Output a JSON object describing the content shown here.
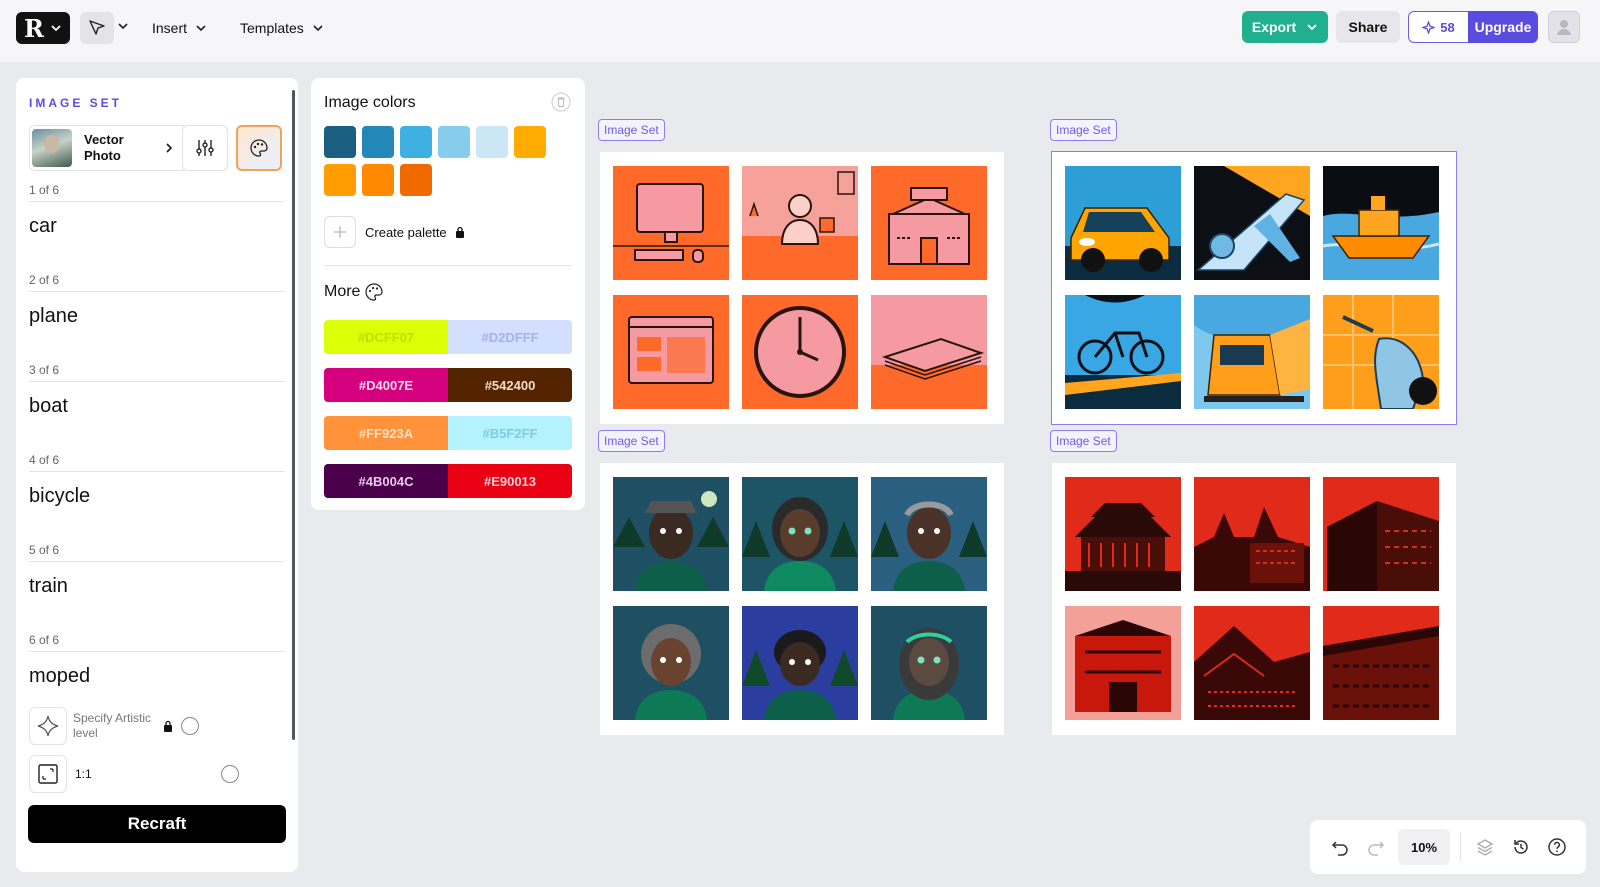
{
  "topbar": {
    "logo_mark": "R",
    "insert_label": "Insert",
    "templates_label": "Templates",
    "export_label": "Export",
    "share_label": "Share",
    "credits_count": "58",
    "upgrade_label": "Upgrade"
  },
  "image_set_panel": {
    "title": "IMAGE SET",
    "model_label": "Vector Photo",
    "items": [
      {
        "count": "1 of 6",
        "word": "car"
      },
      {
        "count": "2 of 6",
        "word": "plane"
      },
      {
        "count": "3 of 6",
        "word": "boat"
      },
      {
        "count": "4 of 6",
        "word": "bicycle"
      },
      {
        "count": "5 of 6",
        "word": "train"
      },
      {
        "count": "6 of 6",
        "word": "moped"
      }
    ],
    "specify_label": "Specify Artistic level",
    "ratio_label": "1:1",
    "recraft_label": "Recraft"
  },
  "colors_panel": {
    "title": "Image colors",
    "swatches": [
      "#1b5f80",
      "#2387b8",
      "#3fb0e2",
      "#85cdeb",
      "#cbe7f6",
      "#ffab00",
      "#ff9d00",
      "#ff8a00",
      "#f06a00"
    ],
    "create_label": "Create palette",
    "more_label": "More",
    "pairs": [
      {
        "left": "#DCFF07",
        "right": "#D2DFFF",
        "left_text": "#c8e600",
        "right_text": "#aab6e8"
      },
      {
        "left": "#D4007E",
        "right": "#542400",
        "left_text": "#ffd9ee",
        "right_text": "#f3dcc8"
      },
      {
        "left": "#FF923A",
        "right": "#B5F2FF",
        "left_text": "#ffe2c8",
        "right_text": "#86d6ea"
      },
      {
        "left": "#4B004C",
        "right": "#E90013",
        "left_text": "#e8c8ea",
        "right_text": "#ffd0d4"
      }
    ]
  },
  "canvas": {
    "set_label": "Image Set",
    "zoom": "10%"
  }
}
